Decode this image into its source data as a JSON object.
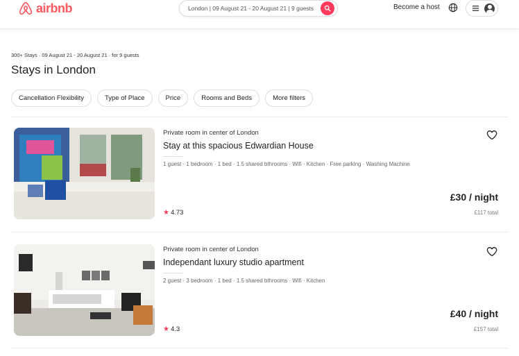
{
  "header": {
    "logo_text": "airbnb",
    "search_text": "London | 09 August 21 - 20 August 21 | 9 guests",
    "become_host": "Become a host",
    "icons": {
      "logo": "airbnb-logo-icon",
      "search": "search-icon",
      "globe": "globe-icon",
      "menu": "hamburger-icon",
      "user": "user-avatar-icon"
    }
  },
  "results": {
    "meta": "300+ Stays · 09 August 21 - 20 August 21 · for 9 guests",
    "title": "Stays in London"
  },
  "filters": [
    {
      "label": "Cancellation Flexibility"
    },
    {
      "label": "Type of Place"
    },
    {
      "label": "Price"
    },
    {
      "label": "Rooms and Beds"
    },
    {
      "label": "More filters"
    }
  ],
  "listings": [
    {
      "subtitle": "Private room in center of London",
      "title": "Stay at this spacious Edwardian House",
      "amenities": "1 guest · 1 bedroom · 1 bed · 1.5 shared bthrooms · Wifi · Kitchen · Free parking · Washing Machine",
      "rating": "4.73",
      "price": "£30 / night",
      "total": "£117 total"
    },
    {
      "subtitle": "Private room in center of London",
      "title": "Independant luxury studio apartment",
      "amenities": "2 guest · 3 bedroom · 1 bed · 1.5 shared bthrooms · Wifi · Kitchen",
      "rating": "4.3",
      "price": "£40 / night",
      "total": "£157 total"
    }
  ],
  "colors": {
    "brand": "#ff5a5f",
    "search_button": "#ff385c",
    "star": "#ff385c"
  }
}
